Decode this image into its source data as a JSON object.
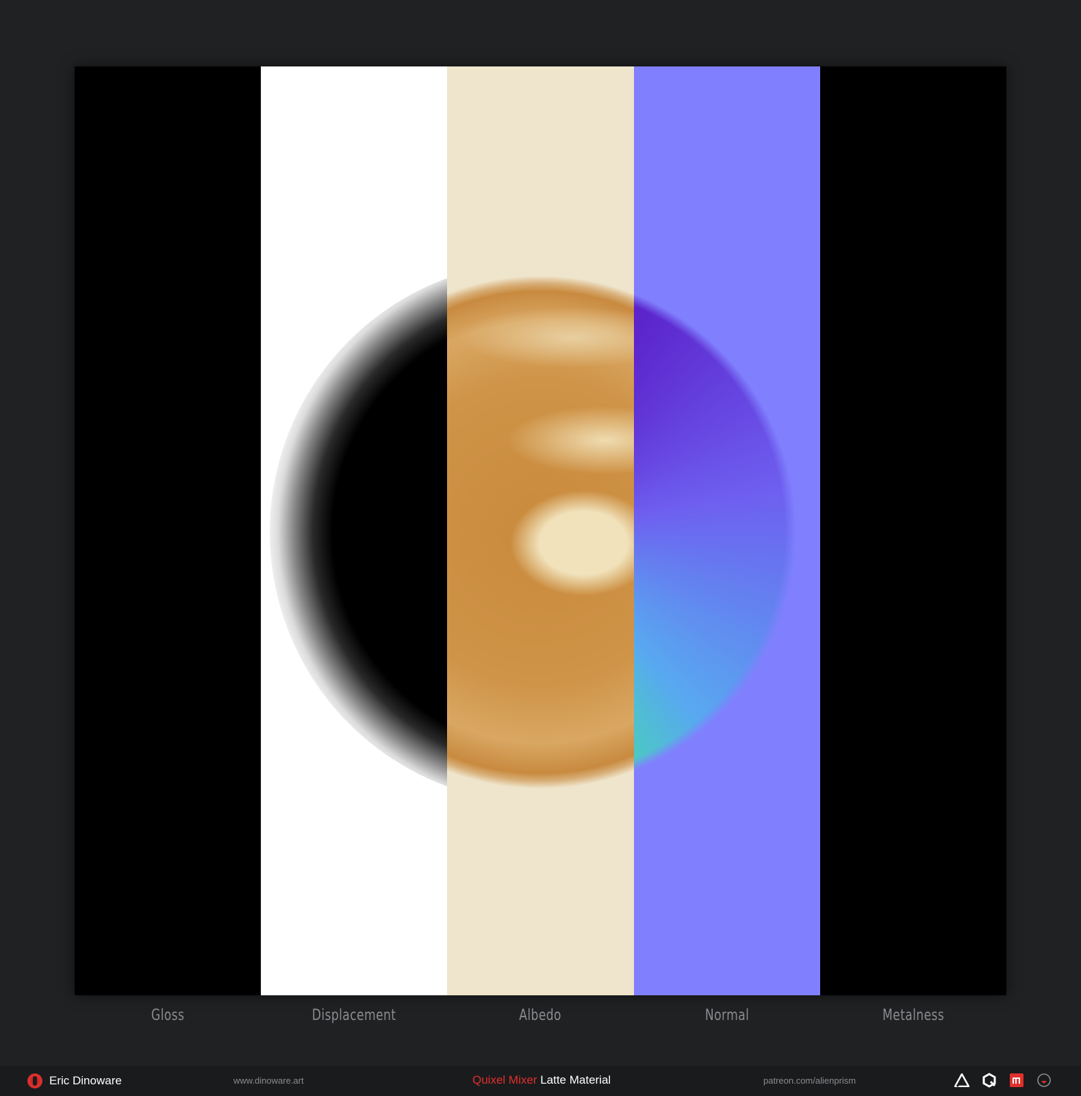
{
  "material_strips": [
    {
      "label": "Gloss"
    },
    {
      "label": "Displacement"
    },
    {
      "label": "Albedo"
    },
    {
      "label": "Normal"
    },
    {
      "label": "Metalness"
    }
  ],
  "colors": {
    "background": "#202123",
    "footer": "#1a1b1d",
    "accent": "#e1302d",
    "albedo_cream": "#efe5cc",
    "normal_flat": "#8080fe",
    "label_gray": "#8b8c90"
  },
  "footer": {
    "author_icon": "dinoware-logo-icon",
    "author_name": "Eric Dinoware",
    "website": "www.dinoware.art",
    "title_accent": "Quixel Mixer",
    "title_rest": " Latte Material",
    "patreon": "patreon.com/alienprism",
    "icons": [
      "artstation-icon",
      "quixel-icon",
      "marmoset-icon",
      "alien-icon"
    ]
  }
}
